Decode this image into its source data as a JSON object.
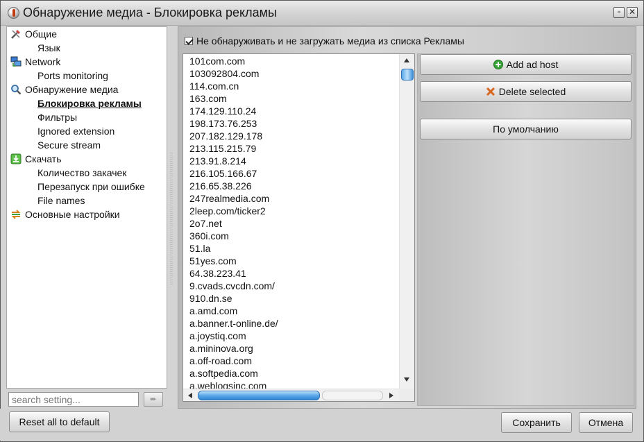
{
  "window": {
    "title": "Обнаружение медиа - Блокировка рекламы"
  },
  "sidebar": {
    "items": [
      {
        "label": "Общие",
        "level": 0,
        "icon": "tools-icon"
      },
      {
        "label": "Язык",
        "level": 1
      },
      {
        "label": "Network",
        "level": 0,
        "icon": "network-icon"
      },
      {
        "label": "Ports monitoring",
        "level": 1
      },
      {
        "label": "Обнаружение медиа",
        "level": 0,
        "icon": "magnifier-icon"
      },
      {
        "label": "Блокировка рекламы",
        "level": 1,
        "selected": true
      },
      {
        "label": "Фильтры",
        "level": 1
      },
      {
        "label": "Ignored extension",
        "level": 1
      },
      {
        "label": "Secure stream",
        "level": 1
      },
      {
        "label": "Скачать",
        "level": 0,
        "icon": "download-icon"
      },
      {
        "label": "Количество закачек",
        "level": 1
      },
      {
        "label": "Перезапуск при ошибке",
        "level": 1
      },
      {
        "label": "File names",
        "level": 1
      },
      {
        "label": "Основные настройки",
        "level": 0,
        "icon": "settings-arrows-icon"
      }
    ],
    "search_placeholder": "search setting..."
  },
  "main": {
    "checkbox_label": "Не обнаруживать и не загружать медиа из списка Рекламы",
    "checkbox_checked": true,
    "hosts": [
      "101com.com",
      "103092804.com",
      "114.com.cn",
      "163.com",
      "174.129.110.24",
      "198.173.76.253",
      "207.182.129.178",
      "213.115.215.79",
      "213.91.8.214",
      "216.105.166.67",
      "216.65.38.226",
      "247realmedia.com",
      "2leep.com/ticker2",
      "2o7.net",
      "360i.com",
      "51.la",
      "51yes.com",
      "64.38.223.41",
      "9.cvads.cvcdn.com/",
      "910.dn.se",
      "a.amd.com",
      "a.banner.t-online.de/",
      "a.joystiq.com",
      "a.mininova.org",
      "a.off-road.com",
      "a.softpedia.com",
      "a.weblogsinc.com"
    ],
    "buttons": {
      "add": "Add ad host",
      "delete": "Delete selected",
      "default": "По умолчанию"
    }
  },
  "footer": {
    "reset": "Reset all to default",
    "save": "Сохранить",
    "cancel": "Отмена"
  },
  "colors": {
    "accent": "#3b8ed9",
    "add_icon": "#3aa53a",
    "delete_icon": "#d9671e"
  }
}
